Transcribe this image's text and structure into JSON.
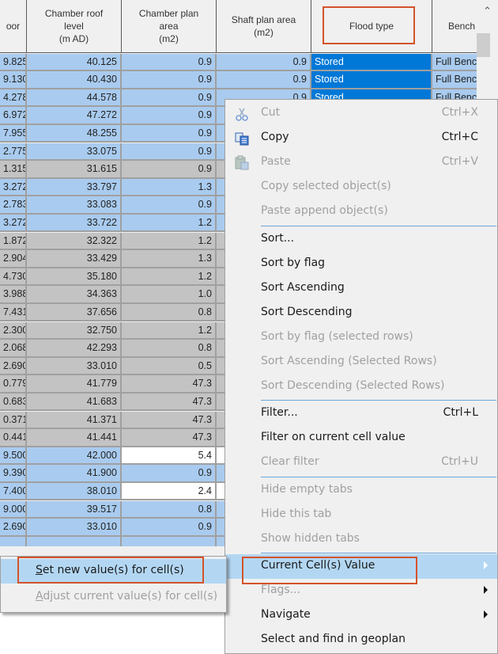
{
  "grid": {
    "headers": [
      {
        "label": "oor"
      },
      {
        "label": "Chamber roof\nlevel\n(m AD)"
      },
      {
        "label": "Chamber plan\narea\n(m2)"
      },
      {
        "label": "Shaft plan area\n(m2)"
      },
      {
        "label": "Flood type"
      },
      {
        "label": "Bench"
      }
    ],
    "rows": [
      {
        "floor": "9.825",
        "roof": "40.125",
        "plan": "0.9",
        "shaft": "0.9",
        "flood": "Stored",
        "bench": "Full Benc"
      },
      {
        "floor": "9.130",
        "roof": "40.430",
        "plan": "0.9",
        "shaft": "0.9",
        "flood": "Stored",
        "bench": "Full Benc"
      },
      {
        "floor": "4.278",
        "roof": "44.578",
        "plan": "0.9",
        "shaft": "0.9",
        "flood": "Stored",
        "bench": "Full Benc"
      },
      {
        "floor": "6.972",
        "roof": "47.272",
        "plan": "0.9"
      },
      {
        "floor": "7.955",
        "roof": "48.255",
        "plan": "0.9"
      },
      {
        "floor": "2.775",
        "roof": "33.075",
        "plan": "0.9"
      },
      {
        "floor": "1.315",
        "roof": "31.615",
        "plan": "0.9"
      },
      {
        "floor": "3.272",
        "roof": "33.797",
        "plan": "1.3"
      },
      {
        "floor": "2.783",
        "roof": "33.083",
        "plan": "0.9"
      },
      {
        "floor": "3.272",
        "roof": "33.722",
        "plan": "1.2"
      },
      {
        "floor": "1.872",
        "roof": "32.322",
        "plan": "1.2"
      },
      {
        "floor": "2.904",
        "roof": "33.429",
        "plan": "1.3"
      },
      {
        "floor": "4.730",
        "roof": "35.180",
        "plan": "1.2"
      },
      {
        "floor": "3.988",
        "roof": "34.363",
        "plan": "1.0"
      },
      {
        "floor": "7.431",
        "roof": "37.656",
        "plan": "0.8"
      },
      {
        "floor": "2.300",
        "roof": "32.750",
        "plan": "1.2"
      },
      {
        "floor": "2.068",
        "roof": "42.293",
        "plan": "0.8"
      },
      {
        "floor": "2.690",
        "roof": "33.010",
        "plan": "0.5"
      },
      {
        "floor": "0.779",
        "roof": "41.779",
        "plan": "47.3"
      },
      {
        "floor": "0.683",
        "roof": "41.683",
        "plan": "47.3"
      },
      {
        "floor": "0.371",
        "roof": "41.371",
        "plan": "47.3"
      },
      {
        "floor": "0.441",
        "roof": "41.441",
        "plan": "47.3"
      },
      {
        "floor": "9.500",
        "roof": "42.000",
        "plan": "5.4"
      },
      {
        "floor": "9.390",
        "roof": "41.900",
        "plan": "0.9"
      },
      {
        "floor": "7.400",
        "roof": "38.010",
        "plan": "2.4"
      },
      {
        "floor": "9.000",
        "roof": "39.517",
        "plan": "0.8"
      },
      {
        "floor": "2.690",
        "roof": "33.010",
        "plan": "0.9"
      }
    ]
  },
  "context_menu": {
    "items": [
      {
        "label": "Cut",
        "shortcut": "Ctrl+X",
        "icon": "scissors-icon",
        "disabled": true
      },
      {
        "label": "Copy",
        "shortcut": "Ctrl+C",
        "icon": "copy-icon",
        "disabled": false
      },
      {
        "label": "Paste",
        "shortcut": "Ctrl+V",
        "icon": "paste-icon",
        "disabled": true
      },
      {
        "label": "Copy selected object(s)",
        "disabled": true
      },
      {
        "label": "Paste append object(s)",
        "disabled": true
      },
      {
        "label": "Sort...",
        "disabled": false
      },
      {
        "label": "Sort by flag",
        "disabled": false
      },
      {
        "label": "Sort Ascending",
        "disabled": false
      },
      {
        "label": "Sort Descending",
        "disabled": false
      },
      {
        "label": "Sort by flag (selected rows)",
        "disabled": true
      },
      {
        "label": "Sort Ascending (Selected Rows)",
        "disabled": true
      },
      {
        "label": "Sort Descending (Selected Rows)",
        "disabled": true
      },
      {
        "label": "Filter...",
        "shortcut": "Ctrl+L",
        "disabled": false
      },
      {
        "label": "Filter on current cell value",
        "disabled": false
      },
      {
        "label": "Clear filter",
        "shortcut": "Ctrl+U",
        "disabled": true
      },
      {
        "label": "Hide empty tabs",
        "disabled": true
      },
      {
        "label": "Hide this tab",
        "disabled": true
      },
      {
        "label": "Show hidden tabs",
        "disabled": true
      },
      {
        "label": "Current Cell(s) Value",
        "disabled": false,
        "submenu": true
      },
      {
        "label": "Flags...",
        "disabled": true,
        "submenu": true
      },
      {
        "label": "Navigate",
        "disabled": false,
        "submenu": true
      },
      {
        "label": "Select and find in geoplan",
        "disabled": false
      }
    ]
  },
  "submenu": {
    "items": [
      {
        "label_u": "S",
        "label_rest": "et new value(s) for cell(s)",
        "disabled": false
      },
      {
        "label_u": "A",
        "label_rest": "djust current value(s) for cell(s)",
        "disabled": true
      }
    ]
  },
  "colors": {
    "row_blue": "#a9cbef",
    "row_gray": "#c3c3c3",
    "selected": "#0078d7",
    "highlight_box": "#d4532b",
    "menu_hover": "#b3d7f3"
  }
}
